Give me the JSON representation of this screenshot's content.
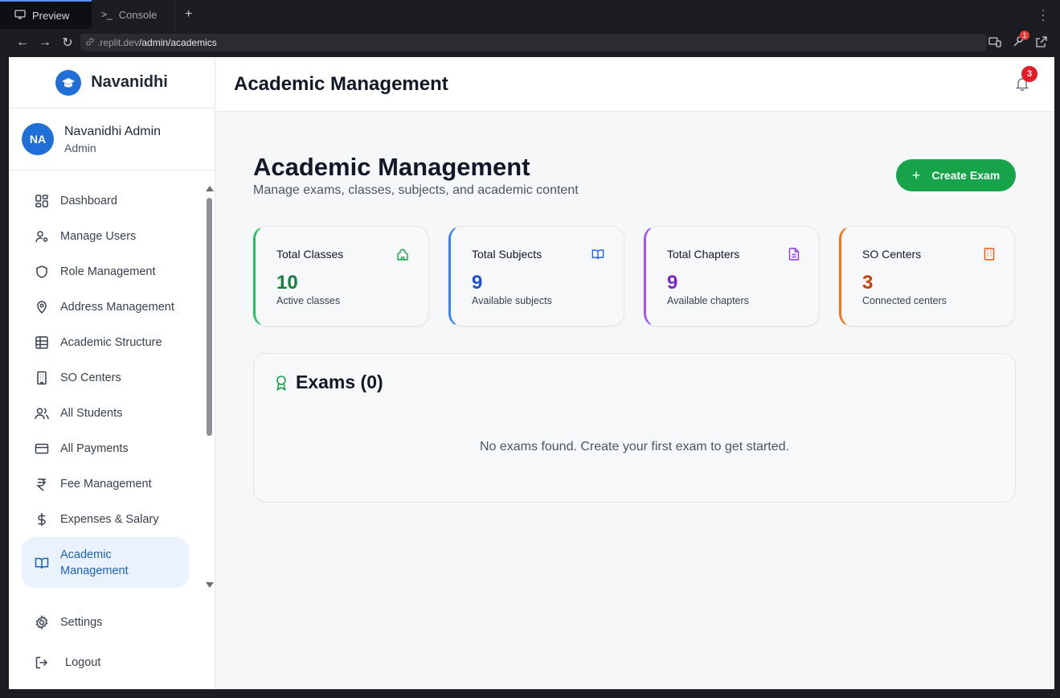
{
  "browser": {
    "tabs": [
      {
        "label": "Preview",
        "icon": "monitor-icon"
      },
      {
        "label": "Console",
        "icon": "terminal-icon"
      }
    ],
    "new_tab": "+",
    "url_host": ".replit.dev",
    "url_path": "/admin/academics",
    "extension_badge": "1"
  },
  "sidebar": {
    "brand": "Navanidhi",
    "user_initials": "NA",
    "user_name": "Navanidhi Admin",
    "user_role": "Admin",
    "items": [
      {
        "label": "Dashboard",
        "icon": "dashboard-icon"
      },
      {
        "label": "Manage Users",
        "icon": "user-cog-icon"
      },
      {
        "label": "Role Management",
        "icon": "shield-icon"
      },
      {
        "label": "Address Management",
        "icon": "map-pin-icon"
      },
      {
        "label": "Academic Structure",
        "icon": "table-icon"
      },
      {
        "label": "SO Centers",
        "icon": "building-icon"
      },
      {
        "label": "All Students",
        "icon": "users-icon"
      },
      {
        "label": "All Payments",
        "icon": "credit-card-icon"
      },
      {
        "label": "Fee Management",
        "icon": "rupee-icon"
      },
      {
        "label": "Expenses & Salary",
        "icon": "dollar-icon"
      },
      {
        "label": "Academic Management",
        "icon": "book-open-icon",
        "active": true
      }
    ],
    "settings": "Settings",
    "logout": "Logout"
  },
  "header": {
    "title": "Academic Management",
    "notification_count": "3"
  },
  "main": {
    "title": "Academic Management",
    "subtitle": "Manage exams, classes, subjects, and academic content",
    "create_button": "Create Exam",
    "stats": [
      {
        "label": "Total Classes",
        "value": "10",
        "sub": "Active classes",
        "color": "#22c55e",
        "value_color": "#15803d",
        "icon": "school-icon"
      },
      {
        "label": "Total Subjects",
        "value": "9",
        "sub": "Available subjects",
        "color": "#3b82f6",
        "value_color": "#1d4ed8",
        "icon": "book-open-icon"
      },
      {
        "label": "Total Chapters",
        "value": "9",
        "sub": "Available chapters",
        "color": "#a855f7",
        "value_color": "#7e22ce",
        "icon": "file-text-icon"
      },
      {
        "label": "SO Centers",
        "value": "3",
        "sub": "Connected centers",
        "color": "#f97316",
        "value_color": "#c2410c",
        "icon": "building-icon"
      }
    ],
    "exams_title": "Exams (0)",
    "exams_empty": "No exams found. Create your first exam to get started."
  }
}
